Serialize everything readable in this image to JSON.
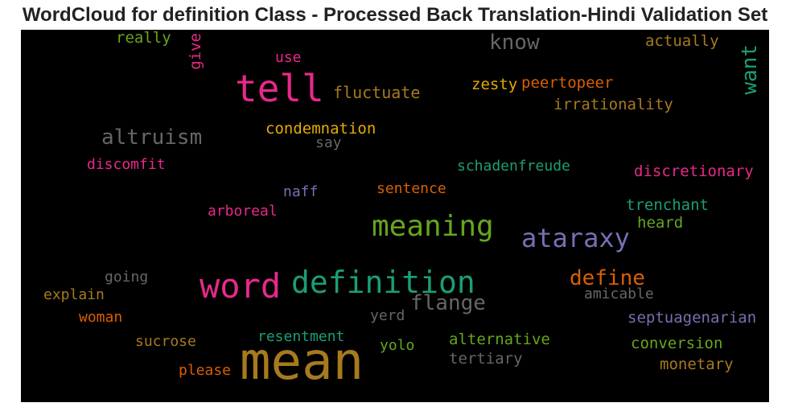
{
  "chart_data": {
    "type": "wordcloud",
    "title": "WordCloud for definition Class - Processed Back Translation-Hindi Validation Set",
    "background": "#000000",
    "words": [
      {
        "text": "mean",
        "size": 64,
        "color": "#a67a1e",
        "orientation": "horizontal"
      },
      {
        "text": "tell",
        "size": 46,
        "color": "#e7298a",
        "orientation": "horizontal"
      },
      {
        "text": "word",
        "size": 42,
        "color": "#e7298a",
        "orientation": "horizontal"
      },
      {
        "text": "definition",
        "size": 38,
        "color": "#1b9e77",
        "orientation": "horizontal"
      },
      {
        "text": "meaning",
        "size": 36,
        "color": "#66a61e",
        "orientation": "horizontal"
      },
      {
        "text": "ataraxy",
        "size": 32,
        "color": "#7570b3",
        "orientation": "horizontal"
      },
      {
        "text": "altruism",
        "size": 26,
        "color": "#666666",
        "orientation": "horizontal"
      },
      {
        "text": "flange",
        "size": 26,
        "color": "#666666",
        "orientation": "horizontal"
      },
      {
        "text": "define",
        "size": 26,
        "color": "#d95f02",
        "orientation": "horizontal"
      },
      {
        "text": "know",
        "size": 26,
        "color": "#666666",
        "orientation": "horizontal"
      },
      {
        "text": "want",
        "size": 26,
        "color": "#1b9e77",
        "orientation": "vertical"
      },
      {
        "text": "fluctuate",
        "size": 20,
        "color": "#a67a1e",
        "orientation": "horizontal"
      },
      {
        "text": "condemnation",
        "size": 19,
        "color": "#e6ab02",
        "orientation": "horizontal"
      },
      {
        "text": "zesty",
        "size": 19,
        "color": "#e6ab02",
        "orientation": "horizontal"
      },
      {
        "text": "peertopeer",
        "size": 19,
        "color": "#d95f02",
        "orientation": "horizontal"
      },
      {
        "text": "irrationality",
        "size": 19,
        "color": "#a67a1e",
        "orientation": "horizontal"
      },
      {
        "text": "actually",
        "size": 19,
        "color": "#a67a1e",
        "orientation": "horizontal"
      },
      {
        "text": "really",
        "size": 19,
        "color": "#66a61e",
        "orientation": "horizontal"
      },
      {
        "text": "give",
        "size": 19,
        "color": "#e7298a",
        "orientation": "vertical"
      },
      {
        "text": "use",
        "size": 18,
        "color": "#e7298a",
        "orientation": "horizontal"
      },
      {
        "text": "say",
        "size": 18,
        "color": "#666666",
        "orientation": "horizontal"
      },
      {
        "text": "discomfit",
        "size": 18,
        "color": "#e7298a",
        "orientation": "horizontal"
      },
      {
        "text": "schadenfreude",
        "size": 18,
        "color": "#1b9e77",
        "orientation": "horizontal"
      },
      {
        "text": "discretionary",
        "size": 19,
        "color": "#e7298a",
        "orientation": "horizontal"
      },
      {
        "text": "naff",
        "size": 18,
        "color": "#7570b3",
        "orientation": "horizontal"
      },
      {
        "text": "sentence",
        "size": 18,
        "color": "#d95f02",
        "orientation": "horizontal"
      },
      {
        "text": "arboreal",
        "size": 18,
        "color": "#e7298a",
        "orientation": "horizontal"
      },
      {
        "text": "trenchant",
        "size": 19,
        "color": "#1b9e77",
        "orientation": "horizontal"
      },
      {
        "text": "heard",
        "size": 19,
        "color": "#66a61e",
        "orientation": "horizontal"
      },
      {
        "text": "going",
        "size": 18,
        "color": "#666666",
        "orientation": "horizontal"
      },
      {
        "text": "explain",
        "size": 18,
        "color": "#a67a1e",
        "orientation": "horizontal"
      },
      {
        "text": "amicable",
        "size": 18,
        "color": "#666666",
        "orientation": "horizontal"
      },
      {
        "text": "woman",
        "size": 18,
        "color": "#d95f02",
        "orientation": "horizontal"
      },
      {
        "text": "yerd",
        "size": 18,
        "color": "#666666",
        "orientation": "horizontal"
      },
      {
        "text": "septuagenarian",
        "size": 19,
        "color": "#7570b3",
        "orientation": "horizontal"
      },
      {
        "text": "resentment",
        "size": 18,
        "color": "#1b9e77",
        "orientation": "horizontal"
      },
      {
        "text": "sucrose",
        "size": 18,
        "color": "#a67a1e",
        "orientation": "horizontal"
      },
      {
        "text": "yolo",
        "size": 18,
        "color": "#66a61e",
        "orientation": "horizontal"
      },
      {
        "text": "alternative",
        "size": 19,
        "color": "#66a61e",
        "orientation": "horizontal"
      },
      {
        "text": "conversion",
        "size": 19,
        "color": "#66a61e",
        "orientation": "horizontal"
      },
      {
        "text": "tertiary",
        "size": 19,
        "color": "#666666",
        "orientation": "horizontal"
      },
      {
        "text": "please",
        "size": 18,
        "color": "#d95f02",
        "orientation": "horizontal"
      },
      {
        "text": "monetary",
        "size": 19,
        "color": "#a67a1e",
        "orientation": "horizontal"
      }
    ]
  }
}
